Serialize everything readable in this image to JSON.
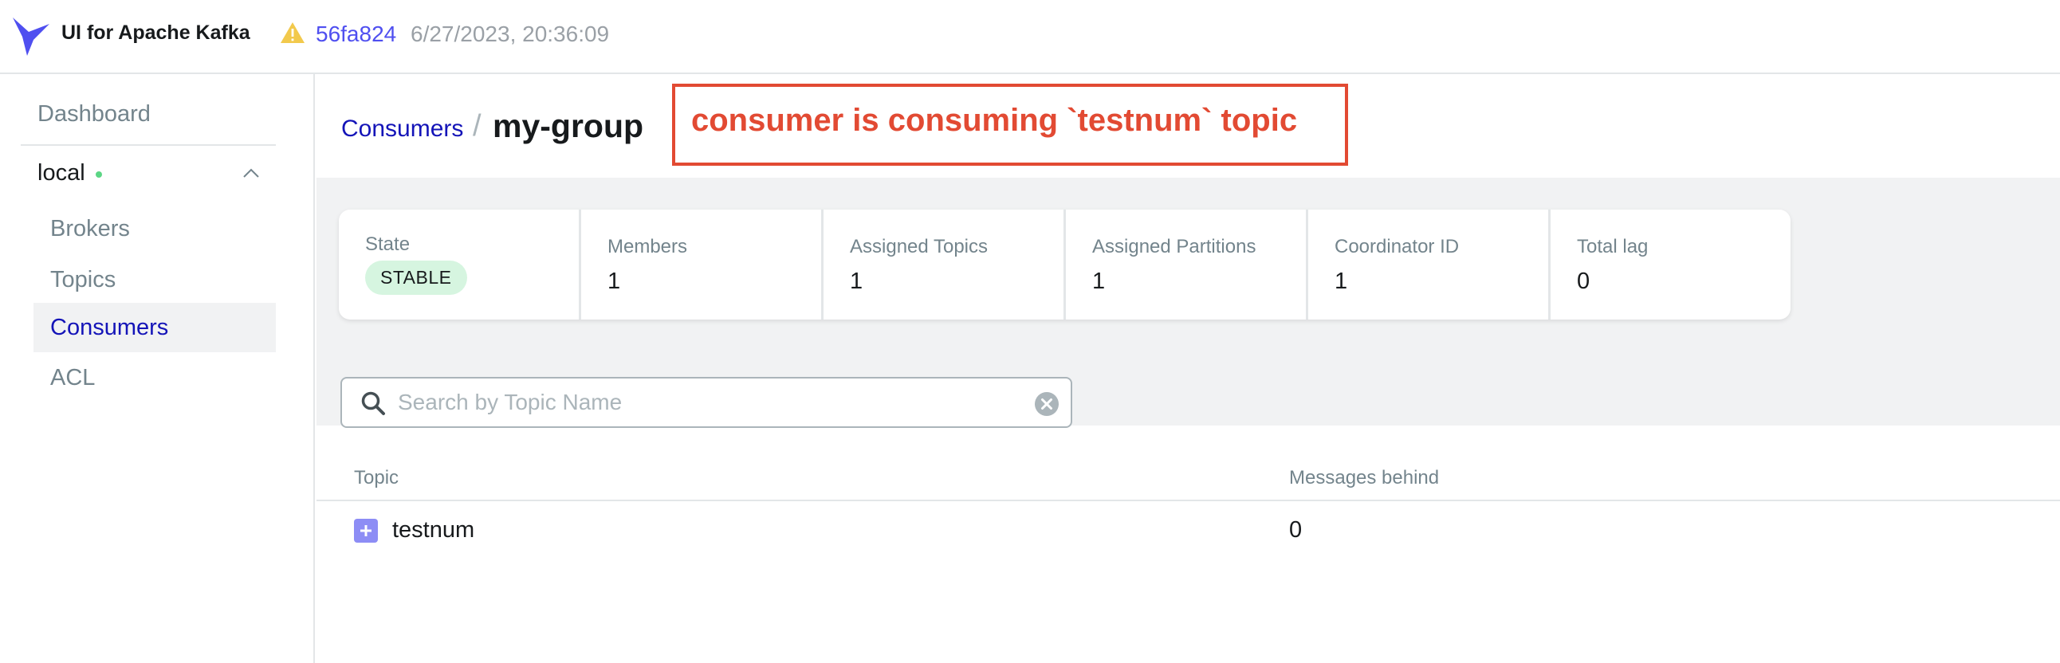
{
  "header": {
    "app_title": "UI for Apache Kafka",
    "commit": "56fa824",
    "build_date": "6/27/2023, 20:36:09",
    "icons": {
      "logo": "kafka-bird-logo",
      "warning": "warning-triangle-icon"
    },
    "colors": {
      "logo": "#4f4ff0",
      "warning": "#f2c94c",
      "link": "#4f4ff0"
    }
  },
  "sidebar": {
    "dashboard": "Dashboard",
    "cluster": {
      "name": "local",
      "status_color": "#5cd685"
    },
    "items": [
      {
        "label": "Brokers",
        "active": false
      },
      {
        "label": "Topics",
        "active": false
      },
      {
        "label": "Consumers",
        "active": true
      },
      {
        "label": "ACL",
        "active": false
      }
    ]
  },
  "breadcrumb": {
    "parent": "Consumers",
    "separator": "/",
    "current": "my-group"
  },
  "annotation": {
    "text": "consumer is consuming `testnum` topic",
    "color": "#e24a33"
  },
  "stats": {
    "state": {
      "label": "State",
      "value": "STABLE"
    },
    "items": [
      {
        "label": "Members",
        "value": "1"
      },
      {
        "label": "Assigned Topics",
        "value": "1"
      },
      {
        "label": "Assigned Partitions",
        "value": "1"
      },
      {
        "label": "Coordinator ID",
        "value": "1"
      },
      {
        "label": "Total lag",
        "value": "0"
      }
    ]
  },
  "search": {
    "placeholder": "Search by Topic Name",
    "value": ""
  },
  "table": {
    "columns": [
      "Topic",
      "Messages behind"
    ],
    "rows": [
      {
        "topic": "testnum",
        "messages_behind": "0"
      }
    ]
  }
}
